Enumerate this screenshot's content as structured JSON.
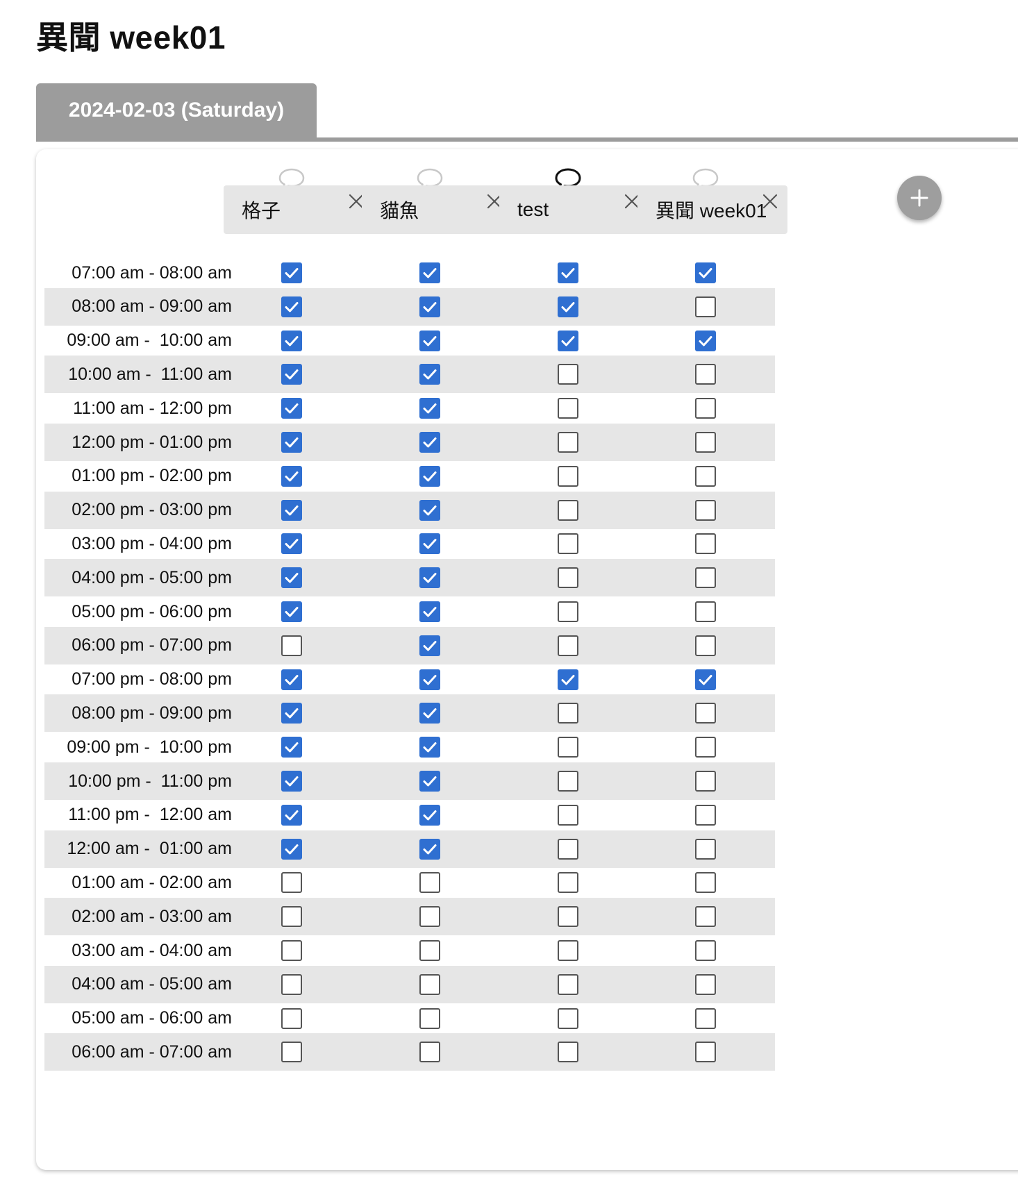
{
  "page": {
    "title": "異聞 week01"
  },
  "tabs": [
    {
      "label": "2024-02-03 (Saturday)",
      "active": true
    }
  ],
  "colors": {
    "checked": "#2f6fd1",
    "tab": "#9c9c9c",
    "stripe": "#e6e6e6",
    "header_cell": "#e6e6e6"
  },
  "columns": [
    {
      "name": "格子",
      "comment_icon": "comment-icon",
      "comment_active": false
    },
    {
      "name": "貓魚",
      "comment_icon": "comment-icon",
      "comment_active": false
    },
    {
      "name": "test",
      "comment_icon": "comment-icon",
      "comment_active": true
    },
    {
      "name": "異聞 week01",
      "comment_icon": "comment-icon",
      "comment_active": false
    }
  ],
  "add_button": {
    "icon": "plus-icon"
  },
  "rows": [
    {
      "time": "07:00 am - 08:00 am",
      "checks": [
        true,
        true,
        true,
        true
      ]
    },
    {
      "time": "08:00 am - 09:00 am",
      "checks": [
        true,
        true,
        true,
        false
      ]
    },
    {
      "time": "09:00 am -  10:00 am",
      "checks": [
        true,
        true,
        true,
        true
      ]
    },
    {
      "time": "10:00 am -  11:00 am",
      "checks": [
        true,
        true,
        false,
        false
      ]
    },
    {
      "time": "11:00 am - 12:00 pm",
      "checks": [
        true,
        true,
        false,
        false
      ]
    },
    {
      "time": "12:00 pm - 01:00 pm",
      "checks": [
        true,
        true,
        false,
        false
      ]
    },
    {
      "time": "01:00 pm - 02:00 pm",
      "checks": [
        true,
        true,
        false,
        false
      ]
    },
    {
      "time": "02:00 pm - 03:00 pm",
      "checks": [
        true,
        true,
        false,
        false
      ]
    },
    {
      "time": "03:00 pm - 04:00 pm",
      "checks": [
        true,
        true,
        false,
        false
      ]
    },
    {
      "time": "04:00 pm - 05:00 pm",
      "checks": [
        true,
        true,
        false,
        false
      ]
    },
    {
      "time": "05:00 pm - 06:00 pm",
      "checks": [
        true,
        true,
        false,
        false
      ]
    },
    {
      "time": "06:00 pm - 07:00 pm",
      "checks": [
        false,
        true,
        false,
        false
      ]
    },
    {
      "time": "07:00 pm - 08:00 pm",
      "checks": [
        true,
        true,
        true,
        true
      ]
    },
    {
      "time": "08:00 pm - 09:00 pm",
      "checks": [
        true,
        true,
        false,
        false
      ]
    },
    {
      "time": "09:00 pm -  10:00 pm",
      "checks": [
        true,
        true,
        false,
        false
      ]
    },
    {
      "time": "10:00 pm -  11:00 pm",
      "checks": [
        true,
        true,
        false,
        false
      ]
    },
    {
      "time": "11:00 pm -  12:00 am",
      "checks": [
        true,
        true,
        false,
        false
      ]
    },
    {
      "time": "12:00 am -  01:00 am",
      "checks": [
        true,
        true,
        false,
        false
      ]
    },
    {
      "time": "01:00 am - 02:00 am",
      "checks": [
        false,
        false,
        false,
        false
      ]
    },
    {
      "time": "02:00 am - 03:00 am",
      "checks": [
        false,
        false,
        false,
        false
      ]
    },
    {
      "time": "03:00 am - 04:00 am",
      "checks": [
        false,
        false,
        false,
        false
      ]
    },
    {
      "time": "04:00 am - 05:00 am",
      "checks": [
        false,
        false,
        false,
        false
      ]
    },
    {
      "time": "05:00 am - 06:00 am",
      "checks": [
        false,
        false,
        false,
        false
      ]
    },
    {
      "time": "06:00 am - 07:00 am",
      "checks": [
        false,
        false,
        false,
        false
      ]
    }
  ]
}
